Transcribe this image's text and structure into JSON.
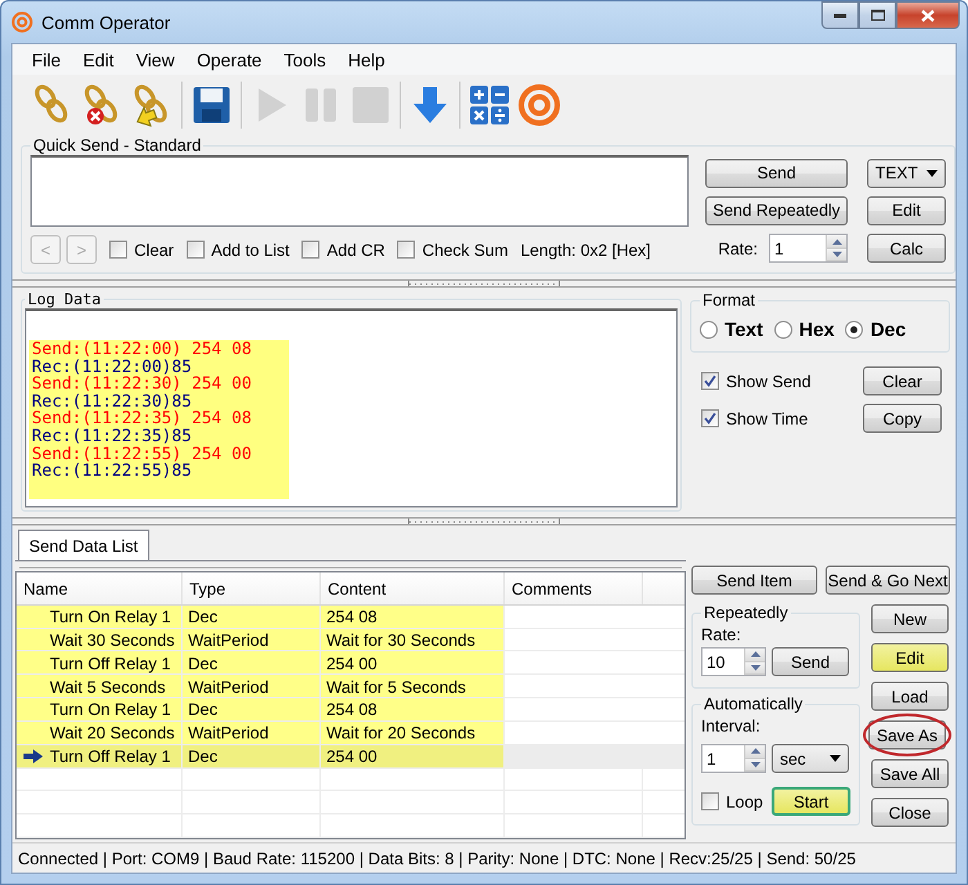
{
  "window": {
    "title": "Comm Operator"
  },
  "menu": [
    "File",
    "Edit",
    "View",
    "Operate",
    "Tools",
    "Help"
  ],
  "toolbar": [
    {
      "kind": "connect",
      "disabled": false
    },
    {
      "kind": "disconnect",
      "disabled": false
    },
    {
      "kind": "settings",
      "disabled": false
    },
    {
      "kind": "save",
      "disabled": false
    },
    {
      "kind": "play",
      "disabled": true
    },
    {
      "kind": "pause",
      "disabled": true
    },
    {
      "kind": "stop",
      "disabled": true
    },
    {
      "kind": "download",
      "disabled": false
    },
    {
      "kind": "calculator",
      "disabled": false
    },
    {
      "kind": "logo",
      "disabled": false
    }
  ],
  "quick_send": {
    "title": "Quick Send - Standard",
    "nav": [
      {
        "label": "<",
        "disabled": true
      },
      {
        "label": ">",
        "disabled": true
      }
    ],
    "options": [
      {
        "label": "Clear",
        "checked": false
      },
      {
        "label": "Add to List",
        "checked": false
      },
      {
        "label": "Add CR",
        "checked": false
      },
      {
        "label": "Check Sum",
        "checked": false
      }
    ],
    "length": "Length: 0x2 [Hex]",
    "send": "Send",
    "send_repeatedly": "Send Repeatedly",
    "format": "TEXT",
    "edit": "Edit",
    "calc": "Calc",
    "rate_label": "Rate:",
    "rate": "1"
  },
  "log": {
    "title": "Log Data",
    "lines": [
      {
        "kind": "send",
        "text": "Send:(11:22:00) 254 08"
      },
      {
        "kind": "rec",
        "text": "Rec:(11:22:00)85"
      },
      {
        "kind": "send",
        "text": "Send:(11:22:30) 254 00"
      },
      {
        "kind": "rec",
        "text": "Rec:(11:22:30)85"
      },
      {
        "kind": "send",
        "text": "Send:(11:22:35) 254 08"
      },
      {
        "kind": "rec",
        "text": "Rec:(11:22:35)85"
      },
      {
        "kind": "send",
        "text": "Send:(11:22:55) 254 00"
      },
      {
        "kind": "rec",
        "text": "Rec:(11:22:55)85"
      }
    ]
  },
  "format": {
    "title": "Format",
    "options": [
      {
        "label": "Text",
        "selected": false
      },
      {
        "label": "Hex",
        "selected": false
      },
      {
        "label": "Dec",
        "selected": true
      }
    ],
    "show": [
      {
        "label": "Show Send",
        "checked": true,
        "button": "Clear"
      },
      {
        "label": "Show Time",
        "checked": true,
        "button": "Copy"
      }
    ]
  },
  "tabs": [
    {
      "label": "Send Data List",
      "selected": true
    }
  ],
  "table": {
    "columns": [
      "Name",
      "Type",
      "Content",
      "Comments"
    ],
    "rows": [
      {
        "cells": [
          "Turn On Relay 1",
          "Dec",
          "254 08"
        ],
        "current": false
      },
      {
        "cells": [
          "Wait 30 Seconds",
          "WaitPeriod",
          "Wait for 30 Seconds"
        ],
        "current": false
      },
      {
        "cells": [
          "Turn Off Relay 1",
          "Dec",
          "254 00"
        ],
        "current": false
      },
      {
        "cells": [
          "Wait 5 Seconds",
          "WaitPeriod",
          "Wait for 5 Seconds"
        ],
        "current": false
      },
      {
        "cells": [
          "Turn On Relay 1",
          "Dec",
          "254 08"
        ],
        "current": false
      },
      {
        "cells": [
          "Wait 20 Seconds",
          "WaitPeriod",
          "Wait for 20 Seconds"
        ],
        "current": false
      },
      {
        "cells": [
          "Turn Off Relay 1",
          "Dec",
          "254 00"
        ],
        "current": true
      }
    ]
  },
  "list_controls": {
    "send_item": "Send Item",
    "send_go_next": "Send & Go Next",
    "repeatedly": {
      "title": "Repeatedly",
      "rate_label": "Rate:",
      "rate": "10",
      "send": "Send"
    },
    "automatically": {
      "title": "Automatically",
      "interval_label": "Interval:",
      "interval": "1",
      "unit": "sec",
      "loop": {
        "label": "Loop",
        "checked": false
      },
      "start": "Start"
    },
    "buttons": [
      {
        "label": "New",
        "highlighted": false,
        "circled": false
      },
      {
        "label": "Edit",
        "highlighted": true,
        "circled": false
      },
      {
        "label": "Load",
        "highlighted": false,
        "circled": false
      },
      {
        "label": "Save As",
        "highlighted": false,
        "circled": true
      },
      {
        "label": "Save All",
        "highlighted": false,
        "circled": false
      },
      {
        "label": "Close",
        "highlighted": false,
        "circled": false
      }
    ]
  },
  "status_bar": "Connected | Port: COM9 | Baud Rate: 115200 | Data Bits: 8 | Parity: None | DTC: None | Recv:25/25 | Send: 50/25"
}
